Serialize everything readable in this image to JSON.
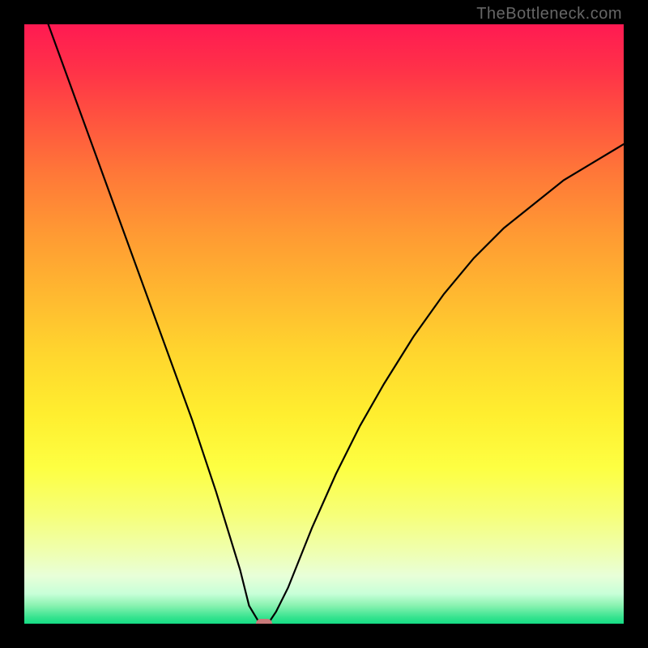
{
  "watermark": "TheBottleneck.com",
  "chart_data": {
    "type": "line",
    "title": "",
    "xlabel": "",
    "ylabel": "",
    "xlim": [
      0,
      100
    ],
    "ylim": [
      0,
      100
    ],
    "grid": false,
    "legend": false,
    "series": [
      {
        "name": "bottleneck-curve",
        "color": "#000000",
        "x": [
          4,
          8,
          12,
          16,
          20,
          24,
          28,
          32,
          36,
          37.5,
          39,
          40,
          41,
          42,
          44,
          48,
          52,
          56,
          60,
          65,
          70,
          75,
          80,
          85,
          90,
          95,
          100
        ],
        "y": [
          100,
          89,
          78,
          67,
          56,
          45,
          34,
          22,
          9,
          3,
          0.5,
          0,
          0.5,
          2,
          6,
          16,
          25,
          33,
          40,
          48,
          55,
          61,
          66,
          70,
          74,
          77,
          80
        ]
      }
    ],
    "marker": {
      "name": "optimal-point",
      "x": 40,
      "y": 0,
      "color": "#c97a7a"
    },
    "background_gradient": {
      "top": "#ff1a52",
      "mid": "#ffd62e",
      "bottom": "#15dd85"
    }
  }
}
